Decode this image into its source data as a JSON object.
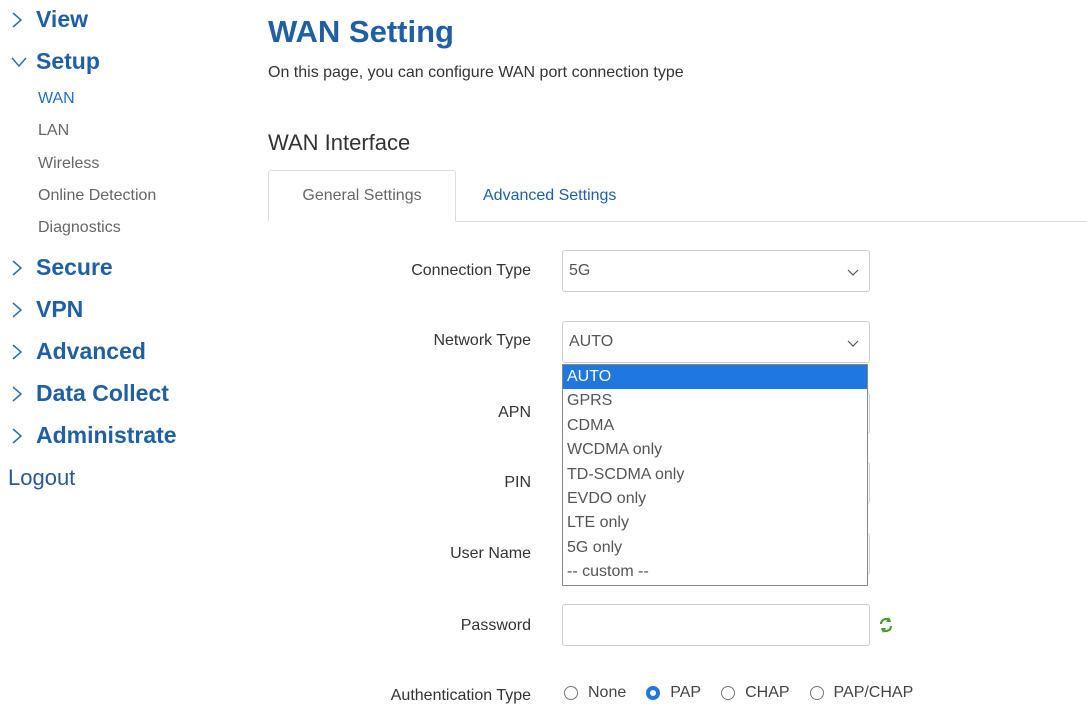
{
  "sidebar": {
    "view": "View",
    "setup": "Setup",
    "setup_items": [
      "WAN",
      "LAN",
      "Wireless",
      "Online Detection",
      "Diagnostics"
    ],
    "secure": "Secure",
    "vpn": "VPN",
    "advanced": "Advanced",
    "data_collect": "Data Collect",
    "administrate": "Administrate",
    "logout": "Logout"
  },
  "page": {
    "title": "WAN Setting",
    "description": "On this page, you can configure WAN port connection type",
    "section": "WAN Interface"
  },
  "tabs": {
    "general": "General Settings",
    "advanced": "Advanced Settings"
  },
  "form": {
    "connection_type_label": "Connection Type",
    "connection_type_value": "5G",
    "network_type_label": "Network Type",
    "network_type_value": "AUTO",
    "network_type_options": [
      "AUTO",
      "GPRS",
      "CDMA",
      "WCDMA only",
      "TD-SCDMA only",
      "EVDO only",
      "LTE only",
      "5G only",
      "-- custom --"
    ],
    "apn_label": "APN",
    "pin_label": "PIN",
    "username_label": "User Name",
    "password_label": "Password",
    "auth_label": "Authentication Type",
    "auth_options": [
      "None",
      "PAP",
      "CHAP",
      "PAP/CHAP"
    ],
    "auth_selected": "PAP"
  },
  "colors": {
    "accent": "#1f5fa6",
    "selected": "#1e78e0",
    "link": "#1f6fc7"
  }
}
